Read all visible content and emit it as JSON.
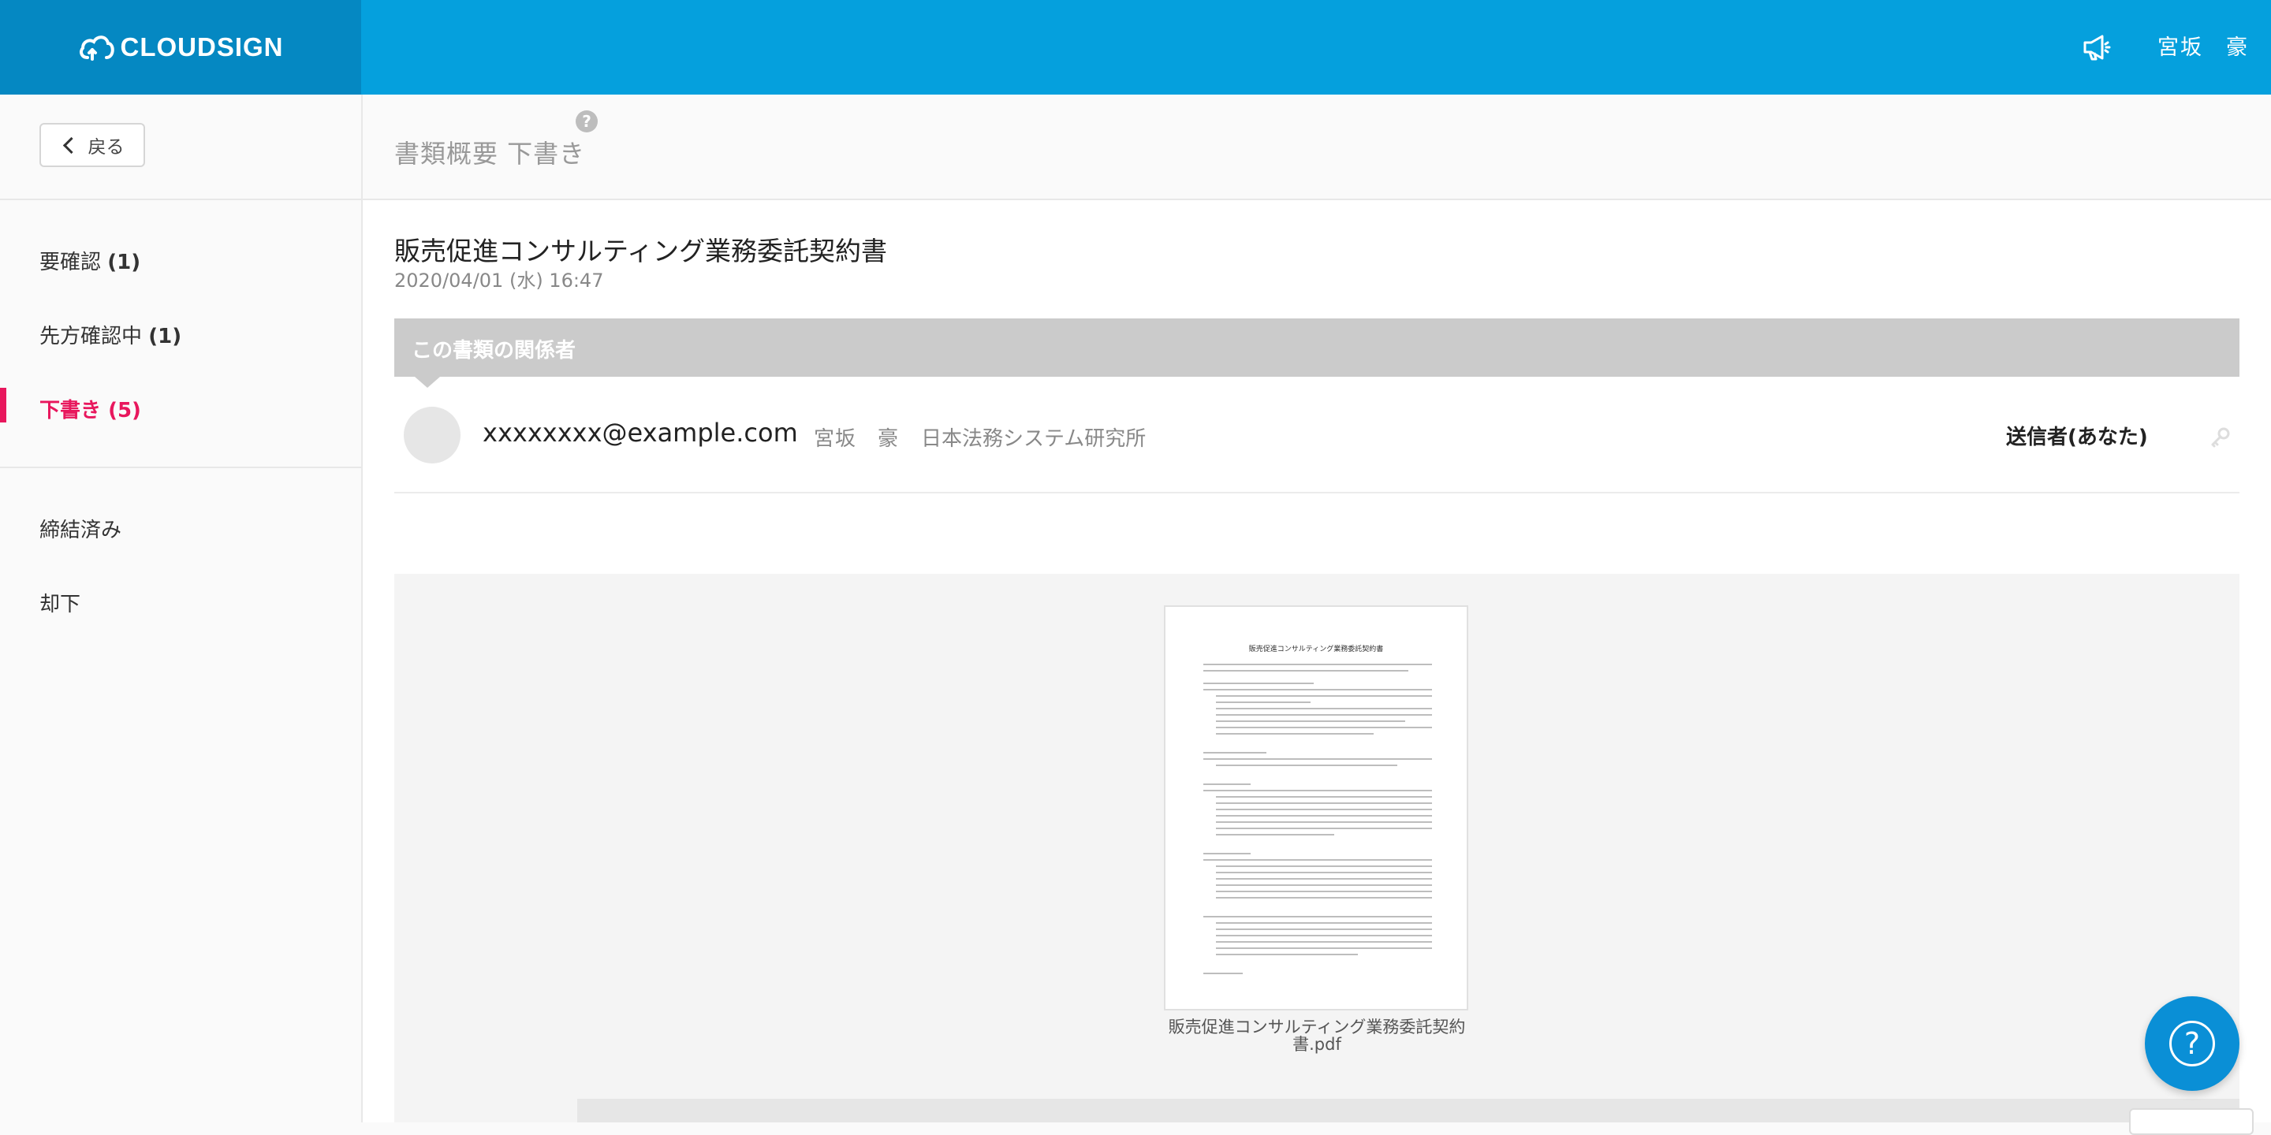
{
  "header": {
    "logo_text": "CLOUDSIGN",
    "user_name": "宮坂　豪",
    "brand_color": "#05a0dd",
    "logo_bg_color": "#0588c2"
  },
  "sidebar": {
    "back_label": "戻る",
    "items": [
      {
        "label": "要確認",
        "count": "(1)",
        "active": false
      },
      {
        "label": "先方確認中",
        "count": "(1)",
        "active": false
      },
      {
        "label": "下書き",
        "count": "(5)",
        "active": true
      },
      {
        "label": "締結済み",
        "count": "",
        "active": false
      },
      {
        "label": "却下",
        "count": "",
        "active": false
      }
    ],
    "active_color": "#e8175d"
  },
  "main": {
    "page_title": "書類概要 下書き",
    "help_glyph": "?",
    "document": {
      "title": "販売促進コンサルティング業務委託契約書",
      "date": "2020/04/01 (水) 16:47"
    },
    "parties_header": "この書類の関係者",
    "party": {
      "email": "xxxxxxxx@example.com",
      "name": "宮坂　豪",
      "organization": "日本法務システム研究所",
      "role": "送信者(あなた)"
    },
    "preview": {
      "thumb_title": "販売促進コンサルティング業務委託契約書",
      "file_name_line1": "販売促進コンサルティング業務委託契約",
      "file_name_line2": "書.pdf"
    }
  },
  "help_fab": {
    "glyph": "?"
  }
}
